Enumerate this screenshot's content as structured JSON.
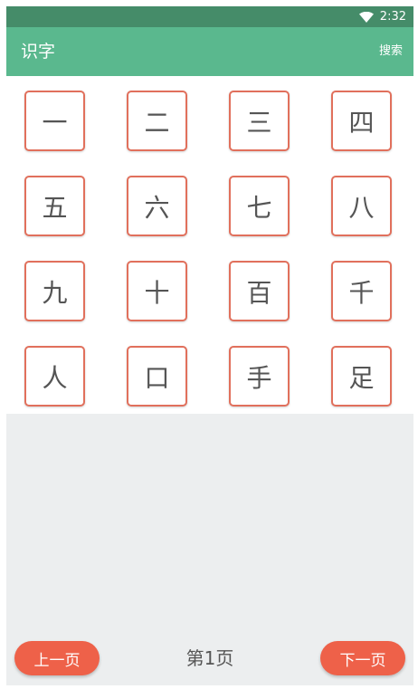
{
  "status_bar": {
    "time": "2:32",
    "wifi_icon": "wifi-icon"
  },
  "app_bar": {
    "title": "识字",
    "search_label": "搜索",
    "color": "#5ab88e"
  },
  "characters": [
    "一",
    "二",
    "三",
    "四",
    "五",
    "六",
    "七",
    "八",
    "九",
    "十",
    "百",
    "千",
    "人",
    "口",
    "手",
    "足"
  ],
  "tile_border_color": "#e1705c",
  "pagination": {
    "prev_label": "上一页",
    "page_label": "第1页",
    "next_label": "下一页",
    "button_color": "#ee6149"
  }
}
